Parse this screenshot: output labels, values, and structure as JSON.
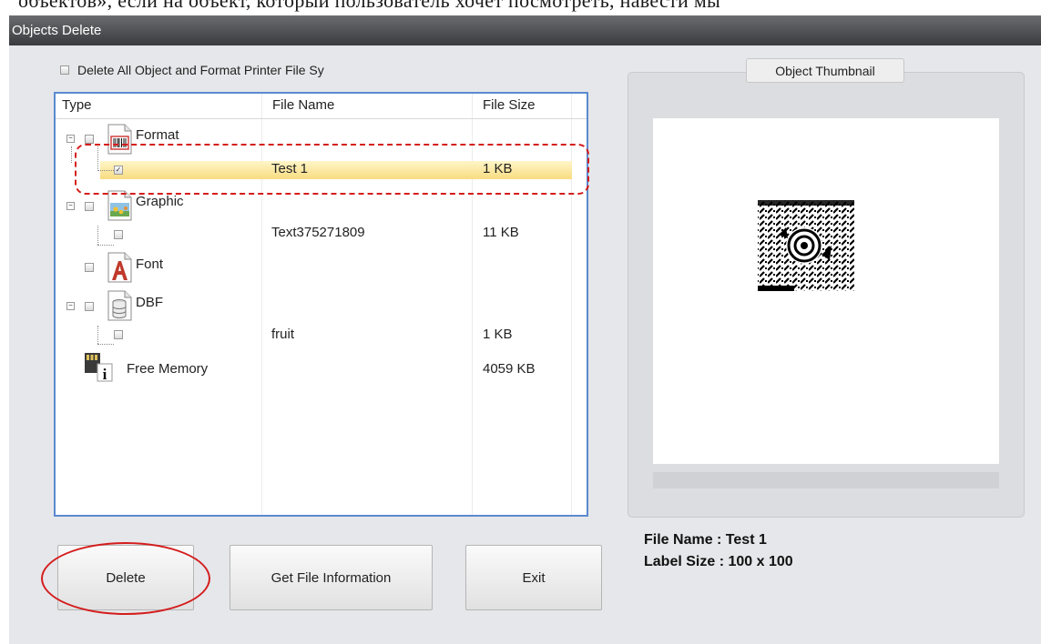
{
  "background_text": "объектов», если на объект, который пользователь хочет посмотреть, навести мы",
  "window": {
    "title": "Objects Delete"
  },
  "delete_all_label": "Delete All Object and Format Printer File Sy",
  "list": {
    "headers": {
      "type": "Type",
      "file_name": "File Name",
      "file_size": "File Size"
    },
    "nodes": {
      "format": {
        "label": "Format",
        "icon": "barcode-format-icon"
      },
      "format_child": {
        "file_name": "Test 1",
        "file_size": "1 KB",
        "checked": true,
        "selected": true
      },
      "graphic": {
        "label": "Graphic",
        "icon": "graphic-image-icon"
      },
      "graphic_child": {
        "file_name": "Text375271809",
        "file_size": "11 KB",
        "checked": false
      },
      "font": {
        "label": "Font",
        "icon": "font-a-icon"
      },
      "dbf": {
        "label": "DBF",
        "icon": "database-icon"
      },
      "dbf_child": {
        "file_name": "fruit",
        "file_size": "1 KB",
        "checked": false
      },
      "memory": {
        "label": "Free Memory",
        "file_size": "4059 KB",
        "icon": "memory-info-icon"
      }
    }
  },
  "thumbnail": {
    "title": "Object Thumbnail",
    "image": "qr-code-thumbnail"
  },
  "file_info": {
    "file_name": "File Name : Test 1",
    "label_size": "Label Size : 100 x 100"
  },
  "buttons": {
    "delete": "Delete",
    "get_info": "Get File Information",
    "exit": "Exit"
  },
  "colors": {
    "selection": "#f8dc80",
    "annotation": "#d41c1c",
    "list_border": "#5b8ad0",
    "titlebar": "#4a4b4e"
  }
}
